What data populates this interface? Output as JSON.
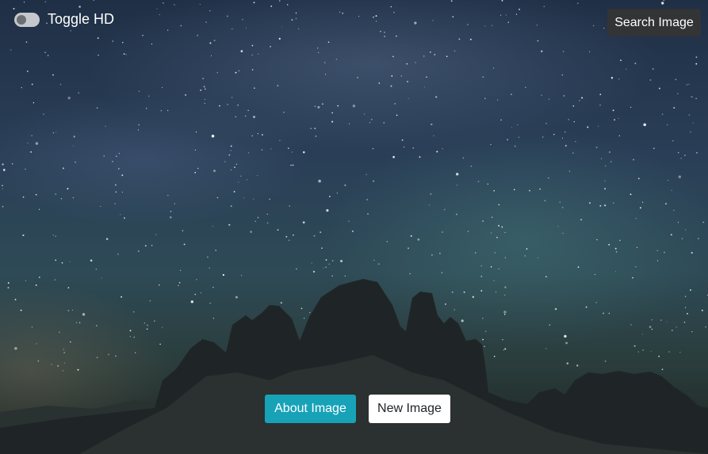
{
  "toggle": {
    "label": "Toggle HD",
    "checked": false
  },
  "buttons": {
    "search": "Search Image",
    "about": "About Image",
    "new": "New Image"
  },
  "colors": {
    "accent": "#17a2b8",
    "search_bg": "#333436",
    "new_bg": "#ffffff"
  }
}
